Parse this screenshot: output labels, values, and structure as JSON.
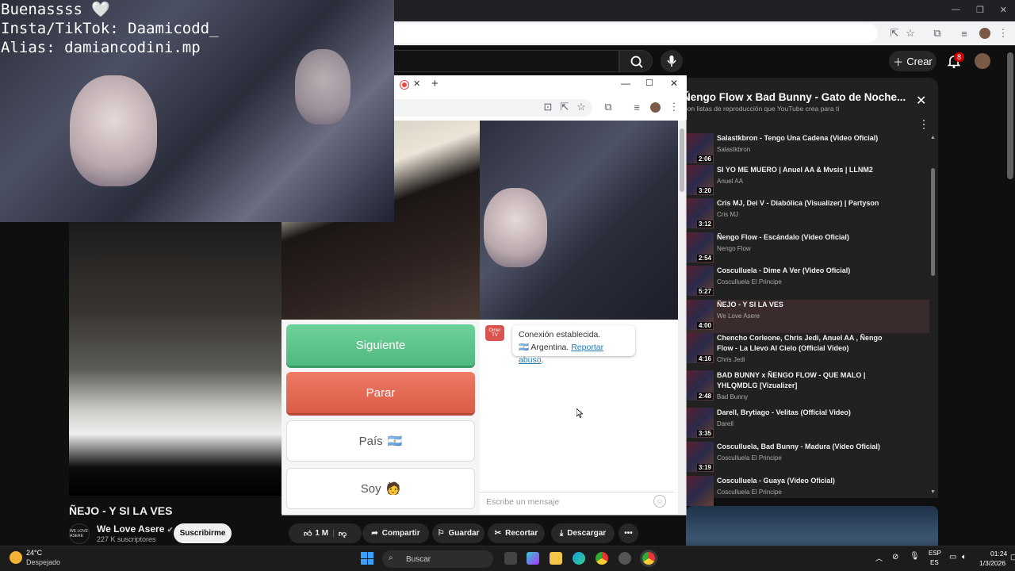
{
  "webcam_overlay": {
    "line1": "Buenassss 🤍",
    "line2": "Insta/TikTok: Daamicodd_",
    "line3": "Alias: damiancodini.mp"
  },
  "youtube": {
    "create_label": "Crear",
    "notification_count": "8",
    "video": {
      "title": "ÑEJO - Y SI LA VES",
      "channel_name": "We Love Asere",
      "channel_logo_text": "WE LOVE ASERE",
      "subscribers": "227 K suscriptores",
      "subscribe_label": "Suscribirme",
      "like_count": "1 M",
      "share_label": "Compartir",
      "save_label": "Guardar",
      "clip_label": "Recortar",
      "download_label": "Descargar"
    },
    "playlist": {
      "title": "Ñengo Flow x Bad Bunny - Gato de Noche...",
      "subtitle": "Son listas de reproducción que YouTube crea para ti",
      "items": [
        {
          "title": "Salastkbron - Tengo Una Cadena (Video Oficial)",
          "channel": "Salastkbron",
          "duration": "2:06"
        },
        {
          "title": "SI YO ME MUERO | Anuel AA & Mvsis | LLNM2",
          "channel": "Anuel AA",
          "duration": "3:20"
        },
        {
          "title": "Cris MJ, Dei V - Diabólica (Visualizer) | Partyson",
          "channel": "Cris MJ",
          "duration": "3:12"
        },
        {
          "title": "Ñengo Flow - Escándalo (Video Oficial)",
          "channel": "Nengo Flow",
          "duration": "2:54"
        },
        {
          "title": "Cosculluela - Dime A Ver (Video Oficial)",
          "channel": "Cosculluela El Principe",
          "duration": "5:27"
        },
        {
          "title": "ÑEJO - Y SI LA VES",
          "channel": "We Love Asere",
          "duration": "4:00",
          "active": true
        },
        {
          "title": "Chencho Corleone, Chris Jedi, Anuel AA , Ñengo Flow - La Llevo Al Cielo (Official Video)",
          "channel": "Chris Jedi",
          "duration": "4:16"
        },
        {
          "title": "BAD BUNNY x ÑENGO FLOW - QUE MALO | YHLQMDLG [Vizualizer]",
          "channel": "Bad Bunny",
          "duration": "2:48"
        },
        {
          "title": "Darell, Brytiago - Velitas (Official Video)",
          "channel": "Darell",
          "duration": "3:35"
        },
        {
          "title": "Cosculluela, Bad Bunny - Madura (Video Oficial)",
          "channel": "Cosculluela El Principe",
          "duration": "3:19"
        },
        {
          "title": "Cosculluela - Guaya (Video Oficial)",
          "channel": "Cosculluela El Principe",
          "duration": ""
        }
      ]
    }
  },
  "popup": {
    "logo_text": "Omeг TV",
    "next_label": "Siguiente",
    "stop_label": "Parar",
    "country_label": "País",
    "country_flag": "🇦🇷",
    "iam_label": "Soy",
    "iam_emoji": "🧑",
    "chat_status": "Conexión establecida.",
    "chat_country": "Argentina.",
    "chat_report": "Reportar abuso",
    "chat_placeholder": "Escribe un mensaje"
  },
  "taskbar": {
    "temperature": "24°C",
    "weather": "Despejado",
    "search_label": "Buscar",
    "lang_top": "ESP",
    "lang_bottom": "ES",
    "time": "01:24",
    "date": "1/3/2026"
  },
  "colors": {
    "next_button": "#5cc48a",
    "stop_button": "#e46a56",
    "yt_bg": "#0f0f0f",
    "active_item": "#3a2c2c"
  }
}
